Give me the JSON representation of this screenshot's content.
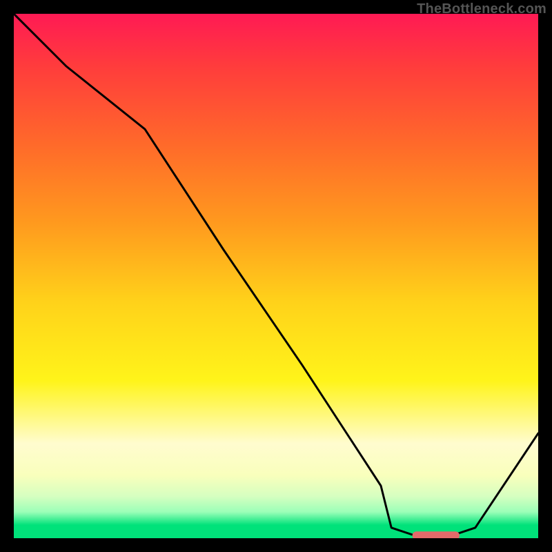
{
  "watermark": "TheBottleneck.com",
  "chart_data": {
    "type": "line",
    "title": "",
    "xlabel": "",
    "ylabel": "",
    "xlim": [
      0,
      100
    ],
    "ylim": [
      0,
      100
    ],
    "grid": false,
    "legend": false,
    "series": [
      {
        "name": "bottleneck-curve",
        "x": [
          0,
          10,
          25,
          40,
          55,
          70,
          72,
          78,
          82,
          88,
          100
        ],
        "y": [
          100,
          90,
          78,
          55,
          33,
          10,
          2,
          0,
          0,
          2,
          20
        ],
        "stroke": "#000000",
        "stroke_width": 3
      }
    ],
    "markers": [
      {
        "name": "optimal-range",
        "shape": "rounded-bar",
        "x_start": 76,
        "x_end": 85,
        "y": 0.5,
        "color": "#e36a6a"
      }
    ],
    "background_gradient": {
      "direction": "vertical",
      "stops": [
        {
          "pos": 0.0,
          "color": "#ff1a54"
        },
        {
          "pos": 0.25,
          "color": "#ff6a2a"
        },
        {
          "pos": 0.55,
          "color": "#ffd21a"
        },
        {
          "pos": 0.85,
          "color": "#fcffc0"
        },
        {
          "pos": 0.97,
          "color": "#00e27a"
        },
        {
          "pos": 1.0,
          "color": "#00e27a"
        }
      ]
    }
  }
}
